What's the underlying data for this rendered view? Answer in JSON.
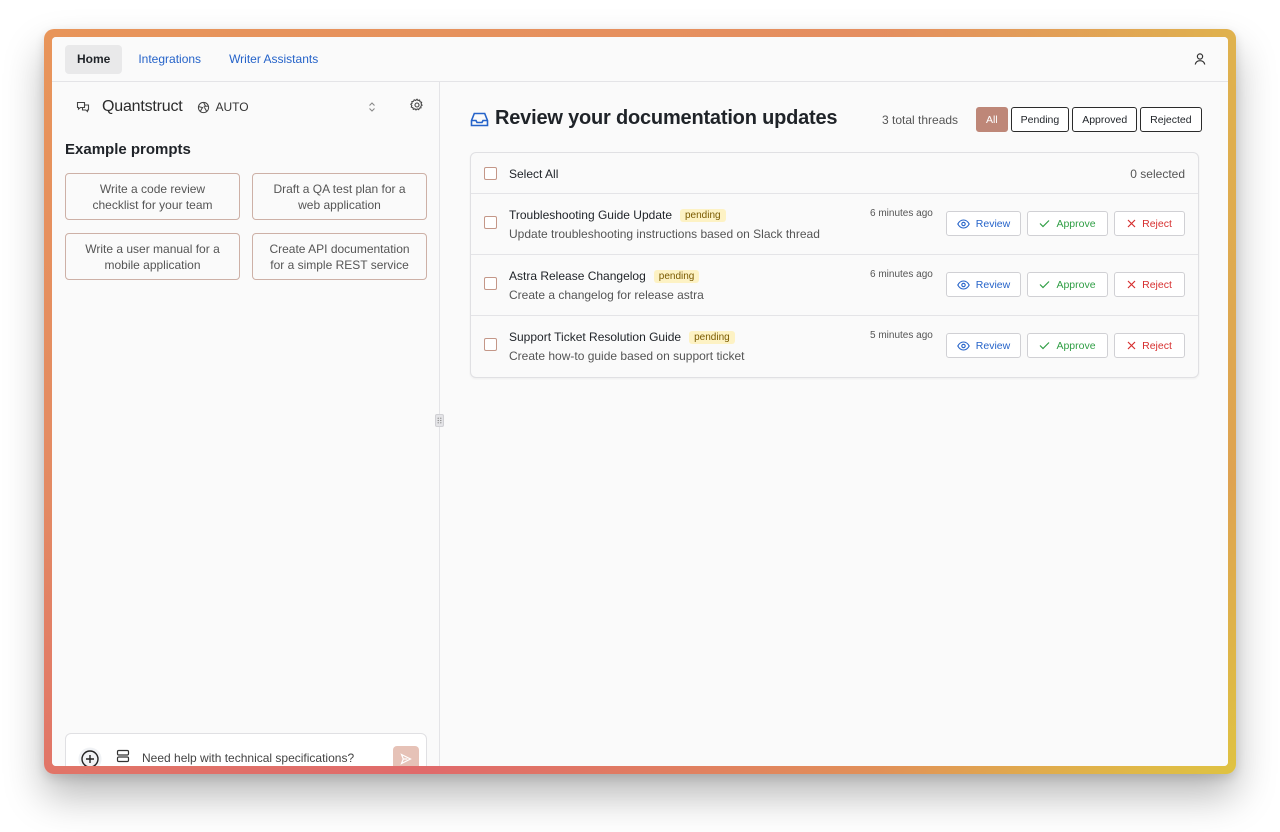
{
  "nav": {
    "tabs": [
      {
        "label": "Home",
        "active": true
      },
      {
        "label": "Integrations",
        "active": false
      },
      {
        "label": "Writer Assistants",
        "active": false
      }
    ],
    "user_icon": "user-icon"
  },
  "sidebar": {
    "brand": "Quantstruct",
    "model_label": "AUTO",
    "prompts_title": "Example prompts",
    "prompts": [
      "Write a code review checklist for your team",
      "Draft a QA test plan for a web application",
      "Write a user manual for a mobile application",
      "Create API documentation for a simple REST service"
    ],
    "chat": {
      "placeholder": "Need help with technical specifications?"
    }
  },
  "main": {
    "title": "Review your documentation updates",
    "total_threads": "3 total threads",
    "filters": [
      {
        "label": "All",
        "active": true
      },
      {
        "label": "Pending",
        "active": false
      },
      {
        "label": "Approved",
        "active": false
      },
      {
        "label": "Rejected",
        "active": false
      }
    ],
    "select_all": "Select All",
    "selected_count": "0 selected",
    "actions": {
      "review": "Review",
      "approve": "Approve",
      "reject": "Reject"
    },
    "threads": [
      {
        "title": "Troubleshooting Guide Update",
        "status": "pending",
        "description": "Update troubleshooting instructions based on Slack thread",
        "time": "6 minutes ago"
      },
      {
        "title": "Astra Release Changelog",
        "status": "pending",
        "description": "Create a changelog for release astra",
        "time": "6 minutes ago"
      },
      {
        "title": "Support Ticket Resolution Guide",
        "status": "pending",
        "description": "Create how-to guide based on support ticket",
        "time": "5 minutes ago"
      }
    ]
  },
  "colors": {
    "accent": "#be8778",
    "link": "#2563c9",
    "approve": "#2f9e44",
    "reject": "#d62f2f",
    "badge_bg": "#fdf2c4"
  }
}
